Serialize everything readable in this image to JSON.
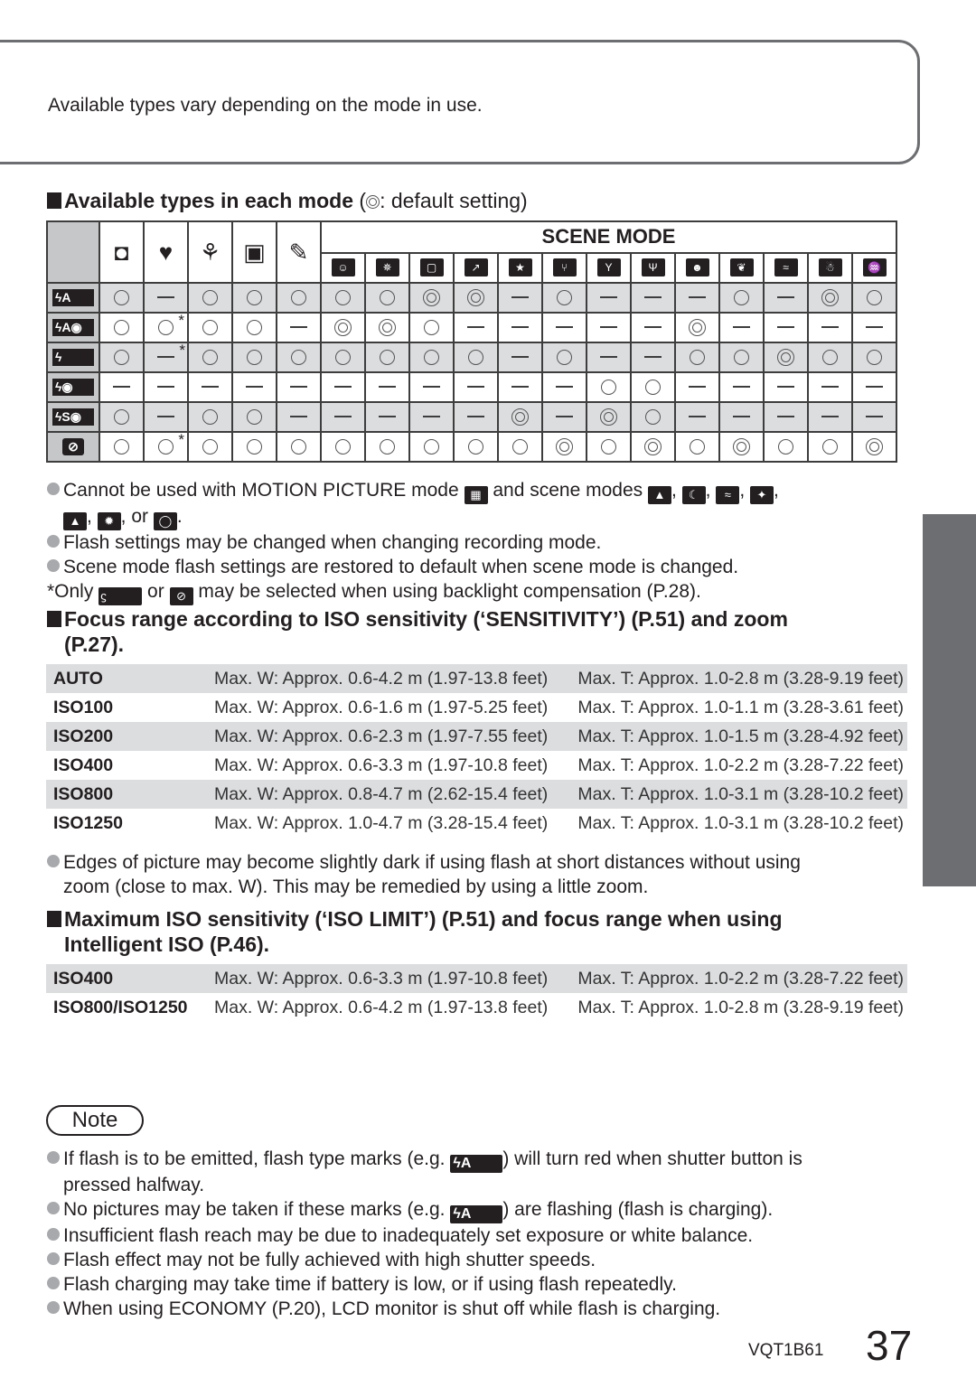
{
  "intro_box": {
    "text": "Available types vary depending on the mode in use."
  },
  "section1": {
    "title": "Available types in each mode",
    "legend_open": "(",
    "legend_text": ": default setting)"
  },
  "flash_table": {
    "scene_mode_header": "SCENE MODE",
    "mode_columns": [
      {
        "icon": "camera-icon",
        "glyph": "◘"
      },
      {
        "icon": "heart-icon",
        "glyph": "♥"
      },
      {
        "icon": "macro-flower-icon",
        "glyph": "⚘"
      },
      {
        "icon": "simple-mode-icon",
        "glyph": "▣"
      },
      {
        "icon": "clipboard-icon",
        "glyph": "✎"
      }
    ],
    "scene_columns": [
      {
        "icon": "portrait-icon",
        "glyph": "☺"
      },
      {
        "icon": "soft-skin-icon",
        "glyph": "✵"
      },
      {
        "icon": "self-portrait-icon",
        "glyph": "▢"
      },
      {
        "icon": "sports-icon",
        "glyph": "↗"
      },
      {
        "icon": "night-portrait-icon",
        "glyph": "★"
      },
      {
        "icon": "food-icon",
        "glyph": "⑂"
      },
      {
        "icon": "party-icon",
        "glyph": "Y"
      },
      {
        "icon": "candle-light-icon",
        "glyph": "Ψ"
      },
      {
        "icon": "baby-icon",
        "glyph": "☻"
      },
      {
        "icon": "pet-icon",
        "glyph": "❦"
      },
      {
        "icon": "beach-icon",
        "glyph": "≈"
      },
      {
        "icon": "snow-icon",
        "glyph": "☃"
      },
      {
        "icon": "underwater-icon",
        "glyph": "♒"
      }
    ],
    "rows": [
      {
        "label": "ϟA",
        "name": "flash-auto",
        "cells": [
          "o",
          "-",
          "o",
          "o",
          "o",
          "o",
          "o",
          "d",
          "d",
          "-",
          "o",
          "-",
          "-",
          "-",
          "o",
          "-",
          "d",
          "o"
        ],
        "asterisk": []
      },
      {
        "label": "ϟA◉",
        "name": "flash-auto-red-eye",
        "cells": [
          "o",
          "o",
          "o",
          "o",
          "-",
          "d",
          "d",
          "o",
          "-",
          "-",
          "-",
          "-",
          "-",
          "d",
          "-",
          "-",
          "-",
          "-"
        ],
        "asterisk": [
          1
        ]
      },
      {
        "label": "ϟ",
        "name": "flash-forced-on",
        "cells": [
          "o",
          "-",
          "o",
          "o",
          "o",
          "o",
          "o",
          "o",
          "o",
          "-",
          "o",
          "-",
          "-",
          "o",
          "o",
          "d",
          "o",
          "o"
        ],
        "asterisk": [
          1
        ]
      },
      {
        "label": "ϟ◉",
        "name": "flash-forced-red-eye",
        "cells": [
          "-",
          "-",
          "-",
          "-",
          "-",
          "-",
          "-",
          "-",
          "-",
          "-",
          "-",
          "o",
          "o",
          "-",
          "-",
          "-",
          "-",
          "-"
        ],
        "asterisk": []
      },
      {
        "label": "ϟS◉",
        "name": "flash-slow-sync-red-eye",
        "cells": [
          "o",
          "-",
          "o",
          "o",
          "-",
          "-",
          "-",
          "-",
          "-",
          "d",
          "-",
          "d",
          "o",
          "-",
          "-",
          "-",
          "-",
          "-"
        ],
        "asterisk": []
      },
      {
        "label": "⊘",
        "name": "flash-forced-off",
        "cells": [
          "o",
          "o",
          "o",
          "o",
          "o",
          "o",
          "o",
          "o",
          "o",
          "o",
          "d",
          "o",
          "d",
          "o",
          "d",
          "o",
          "o",
          "d"
        ],
        "asterisk": [
          1
        ]
      }
    ]
  },
  "notes1": [
    {
      "pre": "Cannot be used with MOTION PICTURE mode",
      "mid": "and scene modes",
      "line2": "or",
      "end": "."
    },
    {
      "text": "Flash settings may be changed when changing recording mode."
    },
    {
      "text": "Scene mode flash settings are restored to default when scene mode is changed."
    },
    {
      "pre": "*Only",
      "mid": "or",
      "post": "may be selected when using backlight compensation (P.28)."
    }
  ],
  "section2": {
    "title_line1": "Focus range according to ISO sensitivity (‘SENSITIVITY’) (P.51) and zoom",
    "title_line2": "(P.27)."
  },
  "focus_table": [
    {
      "key": "AUTO",
      "w": "Max. W: Approx. 0.6-4.2 m (1.97-13.8 feet)",
      "t": "Max. T: Approx. 1.0-2.8 m (3.28-9.19 feet)"
    },
    {
      "key": "ISO100",
      "w": "Max. W: Approx. 0.6-1.6 m (1.97-5.25 feet)",
      "t": "Max. T: Approx. 1.0-1.1 m (3.28-3.61 feet)"
    },
    {
      "key": "ISO200",
      "w": "Max. W: Approx. 0.6-2.3 m (1.97-7.55 feet)",
      "t": "Max. T: Approx. 1.0-1.5 m (3.28-4.92 feet)"
    },
    {
      "key": "ISO400",
      "w": "Max. W: Approx. 0.6-3.3 m (1.97-10.8 feet)",
      "t": "Max. T: Approx. 1.0-2.2 m (3.28-7.22 feet)"
    },
    {
      "key": "ISO800",
      "w": "Max. W: Approx. 0.8-4.7 m (2.62-15.4 feet)",
      "t": "Max. T: Approx. 1.0-3.1 m (3.28-10.2 feet)"
    },
    {
      "key": "ISO1250",
      "w": "Max. W: Approx. 1.0-4.7 m (3.28-15.4 feet)",
      "t": "Max. T: Approx. 1.0-3.1 m (3.28-10.2 feet)"
    }
  ],
  "notes2": {
    "line1": "Edges of picture may become slightly dark if using flash at short distances without using",
    "line2": "zoom (close to max. W). This may be remedied by using a little zoom."
  },
  "section3": {
    "title_line1": "Maximum ISO sensitivity (‘ISO LIMIT’) (P.51) and focus range when using",
    "title_line2": "Intelligent ISO (P.46)."
  },
  "iso_limit_table": [
    {
      "key": "ISO400",
      "w": "Max. W: Approx. 0.6-3.3 m (1.97-10.8 feet)",
      "t": "Max. T: Approx. 1.0-2.2 m (3.28-7.22 feet)"
    },
    {
      "key": "ISO800/ISO1250",
      "w": "Max. W: Approx. 0.6-4.2 m (1.97-13.8 feet)",
      "t": "Max. T: Approx. 1.0-2.8 m (3.28-9.19 feet)"
    }
  ],
  "note_label": "Note",
  "note_items": {
    "i1_pre": "If flash is to be emitted, flash type marks (e.g.",
    "i1_post": ") will turn red when shutter button is",
    "i1_line2": "pressed halfway.",
    "i2_pre": "No pictures may be taken if these marks (e.g.",
    "i2_post": ") are flashing (flash is charging).",
    "i3": "Insufficient flash reach may be due to inadequately set exposure or white balance.",
    "i4": "Flash effect may not be fully achieved with high shutter speeds.",
    "i5": "Flash charging may take time if battery is low, or if using flash repeatedly.",
    "i6": "When using ECONOMY (P.20), LCD monitor is shut off while flash is charging.",
    "flash_mark": "ϟA"
  },
  "footer": {
    "code": "VQT1B61",
    "page": "37"
  }
}
